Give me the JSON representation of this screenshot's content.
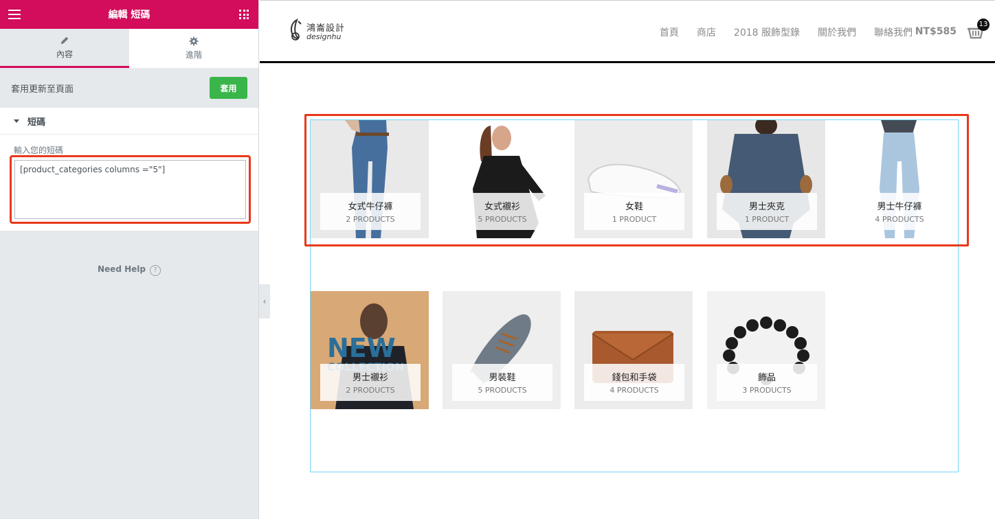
{
  "panel": {
    "title": "編輯 短碼",
    "tabs": [
      {
        "label": "內容",
        "icon": "pencil-icon"
      },
      {
        "label": "進階",
        "icon": "gear-icon"
      }
    ],
    "apply_text": "套用更新至頁面",
    "apply_button": "套用",
    "section_title": "短碼",
    "field_label": "輸入您的短碼",
    "shortcode_value": "[product_categories columns =\"5\"]",
    "help_label": "Need Help",
    "collapse_icon": "chevron-left-icon"
  },
  "site": {
    "logo_zh": "鴻崙設計",
    "logo_en": "designhu",
    "nav": [
      "首頁",
      "商店",
      "2018 服飾型錄",
      "關於我們",
      "聯絡我們"
    ],
    "cart_total": "NT$585",
    "cart_count": "13",
    "accent_color": "#d30c5c",
    "apply_color": "#39b54a",
    "highlight_color": "#e8381a"
  },
  "categories": [
    {
      "name": "女式牛仔褲",
      "count": "2 PRODUCTS"
    },
    {
      "name": "女式襯衫",
      "count": "5 PRODUCTS"
    },
    {
      "name": "女鞋",
      "count": "1 PRODUCT"
    },
    {
      "name": "男士夾克",
      "count": "1 PRODUCT"
    },
    {
      "name": "男士牛仔褲",
      "count": "4 PRODUCTS"
    },
    {
      "name": "男士襯衫",
      "count": "2 PRODUCTS",
      "overlay_text": [
        "NEW",
        "COLLECTION"
      ]
    },
    {
      "name": "男裝鞋",
      "count": "5 PRODUCTS"
    },
    {
      "name": "錢包和手袋",
      "count": "4 PRODUCTS"
    },
    {
      "name": "飾品",
      "count": "3 PRODUCTS"
    }
  ]
}
